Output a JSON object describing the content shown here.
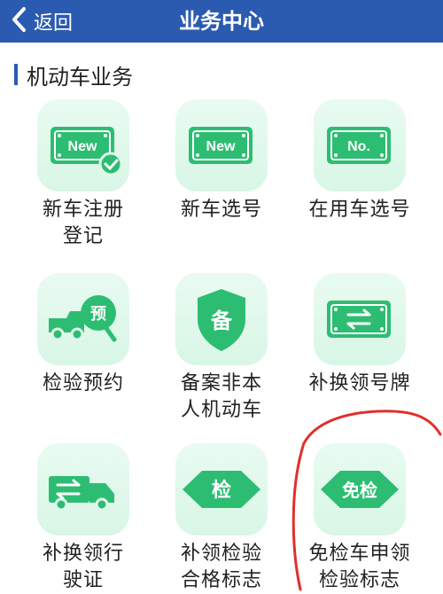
{
  "header": {
    "back_label": "返回",
    "title": "业务中心"
  },
  "section": {
    "title": "机动车业务"
  },
  "tiles": [
    {
      "label": "新车注册\n登记",
      "icon": "new-plate-check-icon",
      "glyph": "New"
    },
    {
      "label": "新车选号",
      "icon": "new-plate-icon",
      "glyph": "New"
    },
    {
      "label": "在用车选号",
      "icon": "no-plate-icon",
      "glyph": "No."
    },
    {
      "label": "检验预约",
      "icon": "truck-appointment-icon",
      "glyph": "预"
    },
    {
      "label": "备案非本\n人机动车",
      "icon": "shield-record-icon",
      "glyph": "备"
    },
    {
      "label": "补换领号牌",
      "icon": "plate-swap-icon",
      "glyph": "⇆"
    },
    {
      "label": "补换领行\n驶证",
      "icon": "truck-swap-icon",
      "glyph": "⇆"
    },
    {
      "label": "补领检验\n合格标志",
      "icon": "inspection-diamond-icon",
      "glyph": "检"
    },
    {
      "label": "免检车申领\n检验标志",
      "icon": "exempt-diamond-icon",
      "glyph": "免检"
    }
  ],
  "colors": {
    "header_bg": "#2a5bb0",
    "icon_green": "#2dbd72",
    "tile_bg": "#dff8ea",
    "annotation_red": "#e0302c"
  }
}
